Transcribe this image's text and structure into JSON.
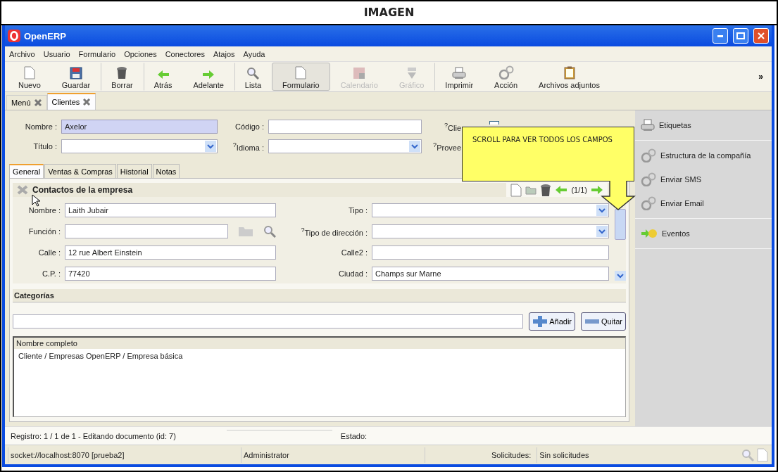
{
  "frame_title": "IMAGEN",
  "window": {
    "title": "OpenERP"
  },
  "menu": [
    "Archivo",
    "Usuario",
    "Formulario",
    "Opciones",
    "Conectores",
    "Atajos",
    "Ayuda"
  ],
  "toolbar": [
    {
      "label": "Nuevo",
      "disabled": false,
      "selected": false,
      "group_start": false
    },
    {
      "label": "Guardar",
      "disabled": false,
      "selected": false,
      "group_start": false
    },
    {
      "label": "Borrar",
      "disabled": false,
      "selected": false,
      "group_start": true
    },
    {
      "label": "Atrás",
      "disabled": false,
      "selected": false,
      "group_start": true
    },
    {
      "label": "Adelante",
      "disabled": false,
      "selected": false,
      "group_start": false
    },
    {
      "label": "Lista",
      "disabled": false,
      "selected": false,
      "group_start": true
    },
    {
      "label": "Formulario",
      "disabled": false,
      "selected": true,
      "group_start": false
    },
    {
      "label": "Calendario",
      "disabled": true,
      "selected": false,
      "group_start": false
    },
    {
      "label": "Gráfico",
      "disabled": true,
      "selected": false,
      "group_start": false
    },
    {
      "label": "Imprimir",
      "disabled": false,
      "selected": false,
      "group_start": true
    },
    {
      "label": "Acción",
      "disabled": false,
      "selected": false,
      "group_start": false
    },
    {
      "label": "Archivos adjuntos",
      "disabled": false,
      "selected": false,
      "group_start": false
    }
  ],
  "toolbar_more": "»",
  "doc_tabs": [
    {
      "label": "Menú",
      "selected": false
    },
    {
      "label": "Clientes",
      "selected": true
    }
  ],
  "header_fields": [
    {
      "label": "Nombre :",
      "kind": "text",
      "value": "Axelor",
      "required": true
    },
    {
      "label": "Código :",
      "kind": "text",
      "required": false
    },
    {
      "label": "$^{?}$Clie",
      "kind": "check",
      "checked": false
    },
    {
      "label": "Título :",
      "kind": "select",
      "required": false
    },
    {
      "label": "$^{?}$Idioma :",
      "kind": "select",
      "required": false
    },
    {
      "label": "$^{?}$Provee",
      "kind": "none"
    }
  ],
  "notebook_tabs": [
    {
      "label": "General",
      "selected": true
    },
    {
      "label": "Ventas & Compras",
      "selected": false
    },
    {
      "label": "Historial",
      "selected": false
    },
    {
      "label": "Notas",
      "selected": false
    }
  ],
  "contacts": {
    "title": "Contactos de la empresa",
    "pager": "(1/1)",
    "fields": [
      {
        "label": "Nombre :",
        "kind": "text",
        "value": "Laith Jubair"
      },
      {
        "label": "Tipo :",
        "kind": "select"
      },
      {
        "label": "Función :",
        "kind": "relation"
      },
      {
        "label": "$^{?}$Tipo de dirección :",
        "kind": "select"
      },
      {
        "label": "Calle :",
        "kind": "text",
        "value": "12 rue Albert Einstein"
      },
      {
        "label": "Calle2 :",
        "kind": "text"
      },
      {
        "label": "C.P. :",
        "kind": "text",
        "value": "77420"
      },
      {
        "label": "Ciudad :",
        "kind": "text",
        "value": "Champs sur Marne"
      }
    ]
  },
  "categories": {
    "title": "Categorías",
    "add": "Añadir",
    "remove": "Quitar",
    "column": "Nombre completo",
    "rows": [
      "Cliente / Empresas OpenERP / Empresa básica"
    ]
  },
  "sidebar": {
    "sections": [
      [
        "Etiquetas"
      ],
      [
        "Estructura de la compañía",
        "Enviar SMS",
        "Enviar Email"
      ],
      [
        "Eventos"
      ]
    ]
  },
  "record_bar": {
    "text": "Registro: 1 / 1 de 1 - Editando documento (id: 7)",
    "state_label": "Estado:"
  },
  "status_bar": {
    "server": "socket://localhost:8070 [prueba2]",
    "user": "Administrator",
    "requests_label": "Solicitudes:",
    "requests": "Sin solicitudes"
  },
  "callout": {
    "text": "SCROLL PARA VER TODOS LOS CAMPOS"
  }
}
